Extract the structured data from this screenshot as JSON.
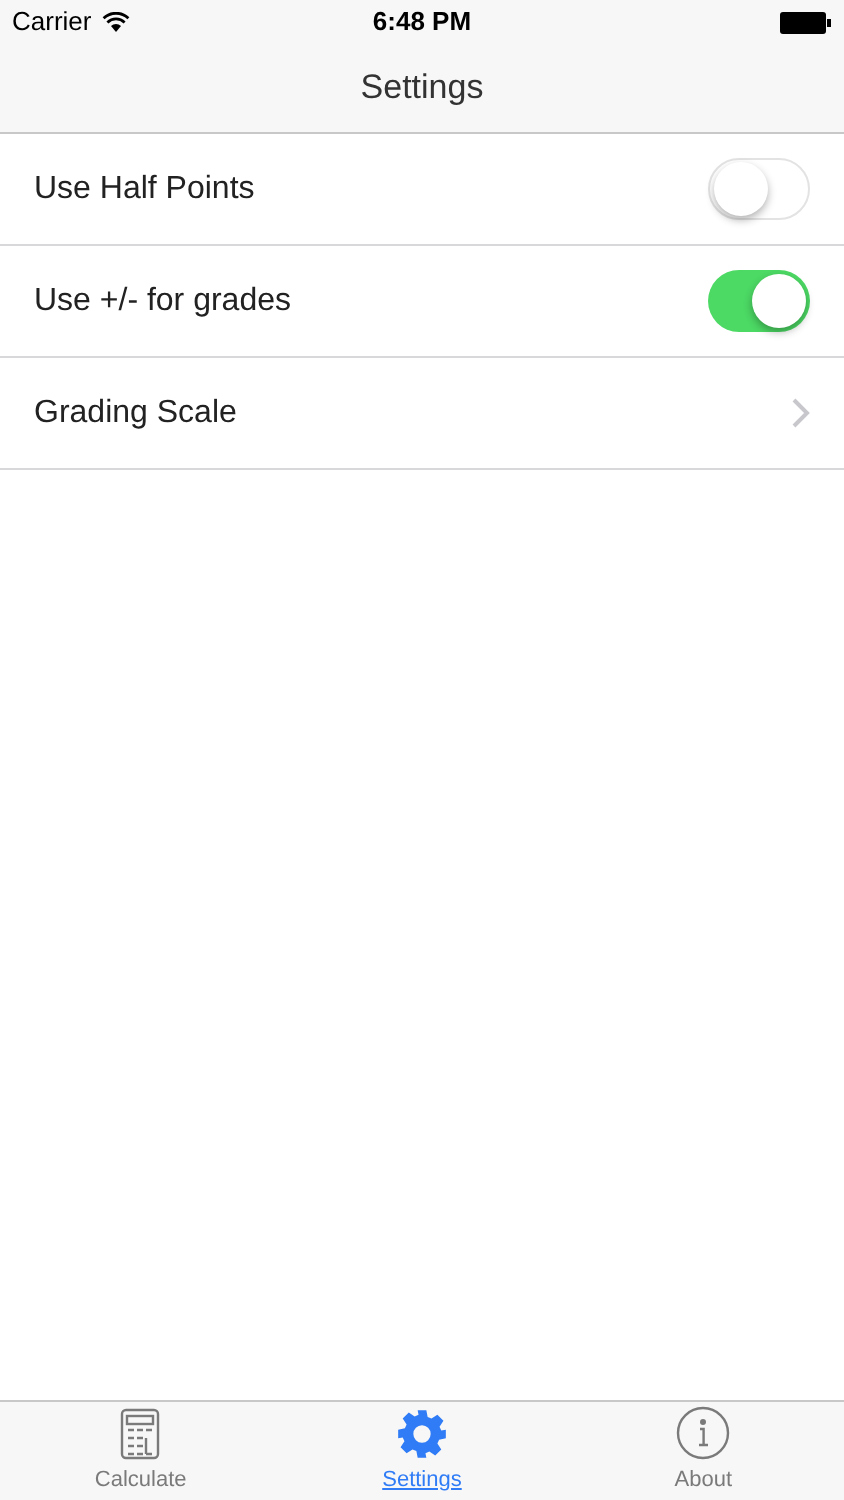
{
  "status_bar": {
    "carrier": "Carrier",
    "time": "6:48 PM"
  },
  "nav_bar": {
    "title": "Settings"
  },
  "settings": [
    {
      "kind": "toggle",
      "label": "Use Half Points",
      "on": false
    },
    {
      "kind": "toggle",
      "label": "Use +/- for grades",
      "on": true
    },
    {
      "kind": "link",
      "label": "Grading Scale"
    }
  ],
  "tab_bar": [
    {
      "kind": "calculator",
      "label": "Calculate",
      "selected": false
    },
    {
      "kind": "gear",
      "label": "Settings",
      "selected": true
    },
    {
      "kind": "info",
      "label": "About",
      "selected": false
    }
  ]
}
